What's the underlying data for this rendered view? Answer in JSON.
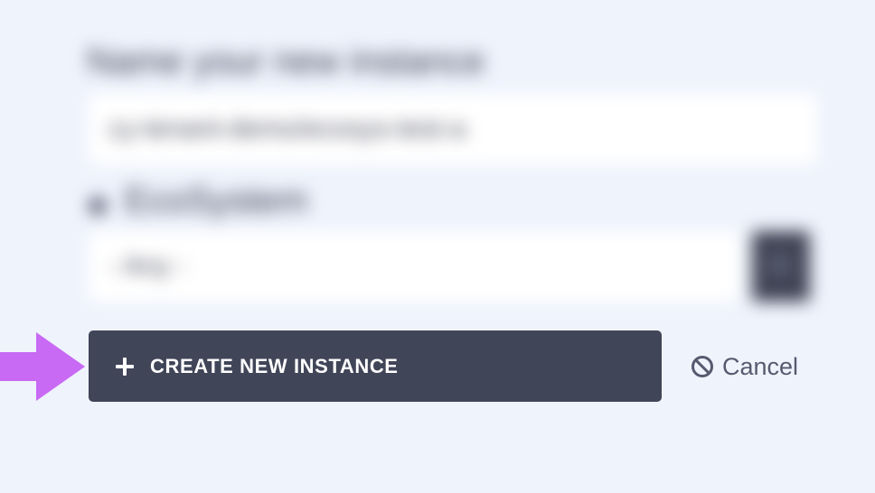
{
  "form": {
    "name_label": "Name your new instance",
    "name_value": "cy-tenant-demo/ecosys-test-a",
    "ecosystem_label": "EcoSystem",
    "ecosystem_value": "- Any -"
  },
  "actions": {
    "create_label": "CREATE NEW INSTANCE",
    "cancel_label": "Cancel"
  },
  "colors": {
    "background": "#eff3fc",
    "primary_button": "#414558",
    "pointer_arrow": "#c86af4",
    "cancel_text": "#555a6e"
  },
  "icons": {
    "create": "plus-icon",
    "cancel": "ban-icon",
    "pointer": "arrow-right-icon"
  }
}
